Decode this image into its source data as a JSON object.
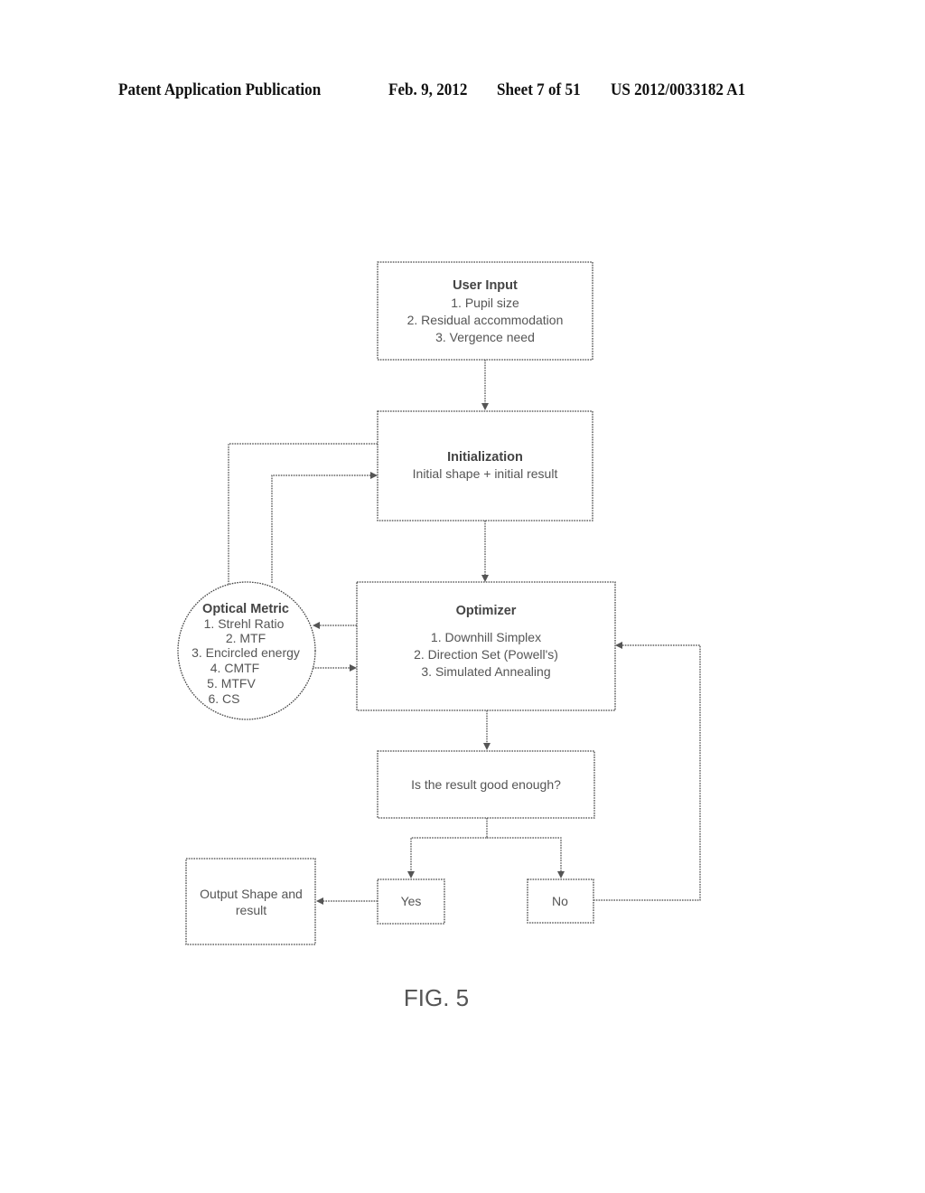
{
  "header": {
    "publication_label": "Patent Application Publication",
    "date": "Feb. 9, 2012",
    "sheet": "Sheet 7 of 51",
    "patent_number": "US 2012/0033182 A1"
  },
  "diagram": {
    "nodes": {
      "user_input": {
        "title": "User Input",
        "items": [
          "1. Pupil size",
          "2. Residual accommodation",
          "3. Vergence need"
        ]
      },
      "initialization": {
        "title": "Initialization",
        "items": [
          "Initial shape + initial result"
        ]
      },
      "optical_metric": {
        "title": "Optical Metric",
        "items": [
          "1. Strehl Ratio",
          "2. MTF",
          "3. Encircled energy",
          "4. CMTF",
          "5. MTFV",
          "6. CS"
        ]
      },
      "optimizer": {
        "title": "Optimizer",
        "items": [
          "1. Downhill Simplex",
          "2. Direction Set (Powell's)",
          "3. Simulated Annealing"
        ]
      },
      "decision": {
        "label": "Is the result good enough?"
      },
      "yes": {
        "label": "Yes"
      },
      "no": {
        "label": "No"
      },
      "output": {
        "lines": [
          "Output Shape and",
          "result"
        ]
      }
    },
    "edges": [
      {
        "from": "user_input",
        "to": "initialization"
      },
      {
        "from": "initialization",
        "to": "optical_metric"
      },
      {
        "from": "optical_metric",
        "to": "initialization"
      },
      {
        "from": "initialization",
        "to": "optimizer"
      },
      {
        "from": "optimizer",
        "to": "optical_metric"
      },
      {
        "from": "optical_metric",
        "to": "optimizer"
      },
      {
        "from": "optimizer",
        "to": "decision"
      },
      {
        "from": "decision",
        "to": "yes"
      },
      {
        "from": "decision",
        "to": "no"
      },
      {
        "from": "yes",
        "to": "output"
      },
      {
        "from": "no",
        "to": "optimizer"
      }
    ],
    "figure_label": "FIG. 5"
  }
}
